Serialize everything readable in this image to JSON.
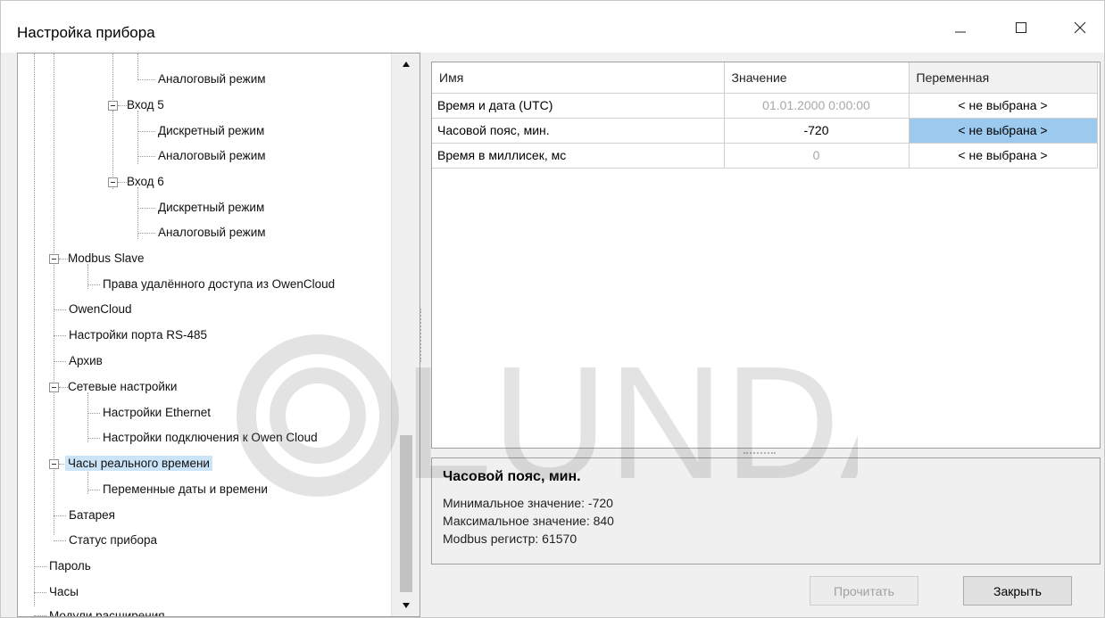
{
  "window": {
    "title": "Настройка прибора",
    "minimize_glyph": "—",
    "maximize_glyph": "☐",
    "close_glyph": "✕"
  },
  "tree": {
    "items": [
      {
        "label": "Аналоговый режим"
      },
      {
        "label": "Вход 5"
      },
      {
        "label": "Дискретный режим"
      },
      {
        "label": "Аналоговый режим"
      },
      {
        "label": "Вход 6"
      },
      {
        "label": "Дискретный режим"
      },
      {
        "label": "Аналоговый режим"
      },
      {
        "label": "Modbus Slave"
      },
      {
        "label": "Права удалённого доступа из OwenCloud"
      },
      {
        "label": "OwenCloud"
      },
      {
        "label": "Настройки порта RS-485"
      },
      {
        "label": "Архив"
      },
      {
        "label": "Сетевые настройки"
      },
      {
        "label": "Настройки Ethernet"
      },
      {
        "label": "Настройки подключения к Owen Cloud"
      },
      {
        "label": "Часы реального времени",
        "selected": true
      },
      {
        "label": "Переменные даты и времени"
      },
      {
        "label": "Батарея"
      },
      {
        "label": "Статус прибора"
      },
      {
        "label": "Пароль"
      },
      {
        "label": "Часы"
      },
      {
        "label": "Модули расширения"
      }
    ]
  },
  "grid": {
    "headers": {
      "name": "Имя",
      "value": "Значение",
      "variable": "Переменная"
    },
    "rows": [
      {
        "name": "Время и дата (UTC)",
        "value": "01.01.2000 0:00:00",
        "variable": "< не выбрана >"
      },
      {
        "name": "Часовой пояс, мин.",
        "value": "-720",
        "variable": "< не выбрана >"
      },
      {
        "name": "Время в миллисек, мс",
        "value": "0",
        "variable": "< не выбрана >"
      }
    ]
  },
  "description": {
    "title": "Часовой пояс, мин.",
    "min": "Минимальное значение: -720",
    "max": "Максимальное значение: 840",
    "register": "Modbus регистр: 61570"
  },
  "buttons": {
    "read": "Прочитать",
    "close": "Закрыть"
  },
  "watermark": {
    "text": "LUNDA"
  },
  "colors": {
    "selected_tree_bg": "#cce4f7",
    "selected_cell_bg": "#9cc9ee",
    "disabled_text": "#a8a8a8"
  }
}
